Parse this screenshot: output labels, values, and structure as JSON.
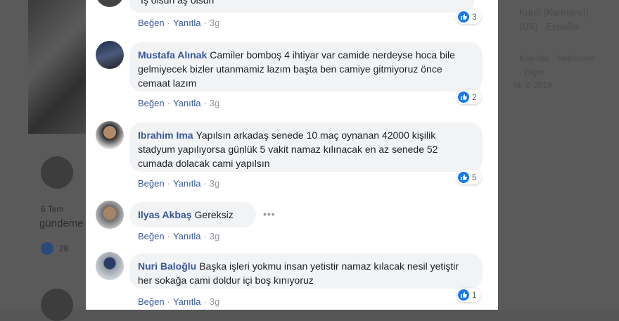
{
  "background": {
    "languages_line1": "Kurdî (Kurmancî)",
    "languages_line2": "(US) · Español",
    "footer_line1": "Koşullar · Reklamlar",
    "footer_line2": "· Diğer ·",
    "footer_line3": "ok © 2019",
    "post_date": "6 Tem",
    "post_text": "gündeme",
    "post_likes": "28"
  },
  "comments": [
    {
      "author": "",
      "text": "İş olsun aş olsun",
      "like_label": "Beğen",
      "reply_label": "Yanıtla",
      "time": "3g",
      "reactions": "3",
      "avatar": "avatar-icon"
    },
    {
      "author": "Mustafa Alınak",
      "text": "Camiler bomboş 4 ihtiyar var camide nerdeyse hoca bile gelmiyecek bizler utanmamiz lazım başta ben camiye gitmiyoruz önce cemaat lazım",
      "like_label": "Beğen",
      "reply_label": "Yanıtla",
      "time": "3g",
      "reactions": "2",
      "avatar": "avatar-icon"
    },
    {
      "author": "Ibrahim Ima",
      "text": "Yapılsın arkadaş senede 10 maç oynanan 42000 kişilik stadyum yapılıyorsa günlük 5 vakit namaz kılınacak en az senede 52 cumada dolacak cami yapılsın",
      "like_label": "Beğen",
      "reply_label": "Yanıtla",
      "time": "3g",
      "reactions": "5",
      "avatar": "avatar-icon"
    },
    {
      "author": "Ilyas Akbaş",
      "text": "Gereksiz",
      "like_label": "Beğen",
      "reply_label": "Yanıtla",
      "time": "3g",
      "reactions": "",
      "avatar": "avatar-icon"
    },
    {
      "author": "Nuri Baloğlu",
      "text": "Başka işleri yokmu insan yetistir namaz kılacak nesil yetiştir her sokağa cami doldur içi boş kınıyoruz",
      "like_label": "Beğen",
      "reply_label": "Yanıtla",
      "time": "3g",
      "reactions": "1",
      "avatar": "avatar-icon"
    }
  ],
  "icons": {
    "like": "thumbs-up-icon",
    "more": "more-options-icon"
  },
  "colors": {
    "author": "#385898",
    "bubble": "#f2f3f5",
    "like_badge": "#1877f2"
  }
}
